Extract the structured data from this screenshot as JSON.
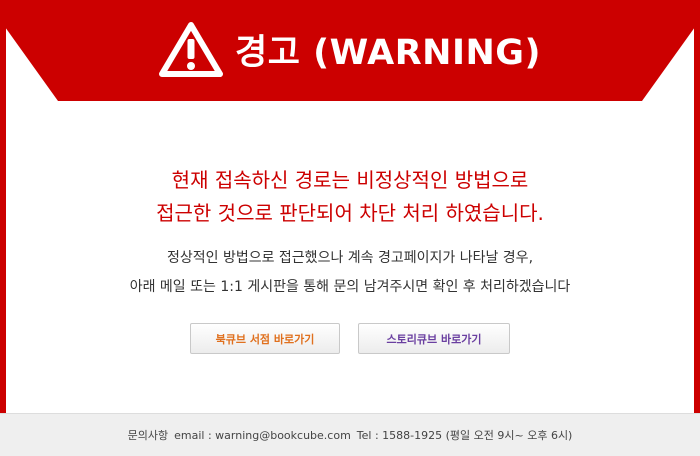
{
  "banner": {
    "title": "경고 (WARNING)",
    "icon": "warning-triangle-icon",
    "color": "#cc0000"
  },
  "message": {
    "line1": "현재 접속하신 경로는 비정상적인 방법으로",
    "line2": "접근한 것으로 판단되어 차단 처리 하였습니다."
  },
  "sub_message": {
    "line1": "정상적인 방법으로 접근했으나 계속 경고페이지가 나타날 경우,",
    "line2": "아래 메일 또는 1:1 게시판을 통해 문의 남겨주시면 확인 후 처리하겠습니다"
  },
  "buttons": {
    "bookcube_label": "북큐브 서점 바로가기",
    "storycube_label": "스토리큐브 바로가기"
  },
  "footer": {
    "contact_label": "문의사항",
    "email": "email : warning@bookcube.com",
    "tel": "Tel : 1588-1925 (평일 오전 9시~ 오후 6시)"
  }
}
